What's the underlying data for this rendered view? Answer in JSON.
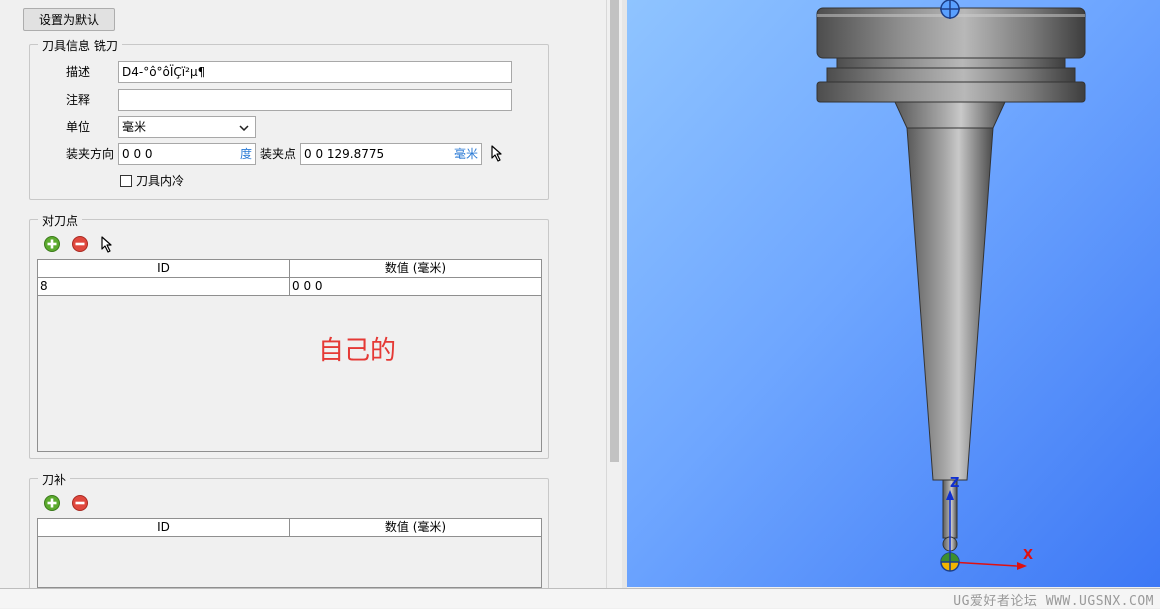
{
  "set_default_button": "设置为默认",
  "tool_info": {
    "legend": "刀具信息 铣刀",
    "description_label": "描述",
    "description_value": "D4-°ô°ôÏÇï²µ¶",
    "comment_label": "注释",
    "comment_value": "",
    "unit_label": "单位",
    "unit_value": "毫米",
    "clamp_dir_label": "装夹方向",
    "clamp_dir_value": "0 0 0",
    "clamp_dir_unit": "度",
    "clamp_point_label": "装夹点",
    "clamp_point_value": "0 0 129.8775",
    "clamp_point_unit": "毫米",
    "coolant_label": "刀具内冷",
    "coolant_checked": false
  },
  "tool_point": {
    "legend": "对刀点",
    "columns": [
      "ID",
      "数值 (毫米)"
    ],
    "rows": [
      [
        "8",
        "0 0 0"
      ]
    ],
    "annotation": "自己的"
  },
  "tool_comp": {
    "legend": "刀补",
    "columns": [
      "ID",
      "数值 (毫米)"
    ]
  },
  "viewport": {
    "axis_z": "Z",
    "axis_x": "X",
    "watermark": "UG爱好者论坛 WWW.UGSNX.COM"
  },
  "colors": {
    "annotation_red": "#e53935",
    "unit_blue": "#2a7ad5",
    "view_bg_top": "#8fc4ff",
    "view_bg_bottom": "#3d78f5"
  }
}
